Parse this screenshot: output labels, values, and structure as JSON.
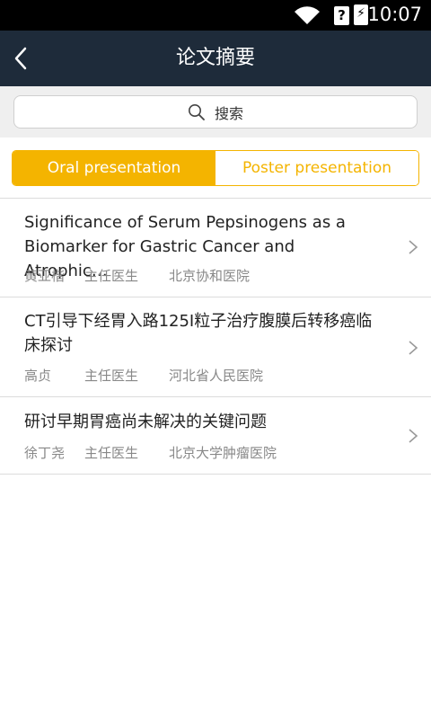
{
  "status_bar": {
    "time": "10:07",
    "icons": [
      "wifi-icon",
      "signal-unknown-icon",
      "battery-charging-icon"
    ],
    "sim_glyph": "?",
    "battery_glyph": "⚡"
  },
  "nav": {
    "title": "论文摘要",
    "back_icon": "chevron-left-icon"
  },
  "search": {
    "label": "搜索",
    "icon": "search-icon"
  },
  "tabs": [
    {
      "label": "Oral presentation",
      "active": true
    },
    {
      "label": "Poster presentation",
      "active": false
    }
  ],
  "colors": {
    "accent": "#f4b400",
    "nav_bg": "#1e2b3a",
    "text_primary": "#222222",
    "text_secondary": "#888888"
  },
  "papers": [
    {
      "title_line1": "Significance of Serum Pepsinogens as a",
      "title_line2": "Biomarker for Gastric Cancer and Atrophic…",
      "author": "黄亚楷",
      "position": "主任医生",
      "hospital": "北京协和医院"
    },
    {
      "title_line1": "CT引导下经胃入路125I粒子治疗腹膜后转移癌临",
      "title_line2": "床探讨",
      "author": "高贞",
      "position": "主任医生",
      "hospital": "河北省人民医院"
    },
    {
      "title_line1": "研讨早期胃癌尚未解决的关键问题",
      "title_line2": "",
      "author": "徐丁尧",
      "position": "主任医生",
      "hospital": "北京大学肿瘤医院"
    }
  ]
}
